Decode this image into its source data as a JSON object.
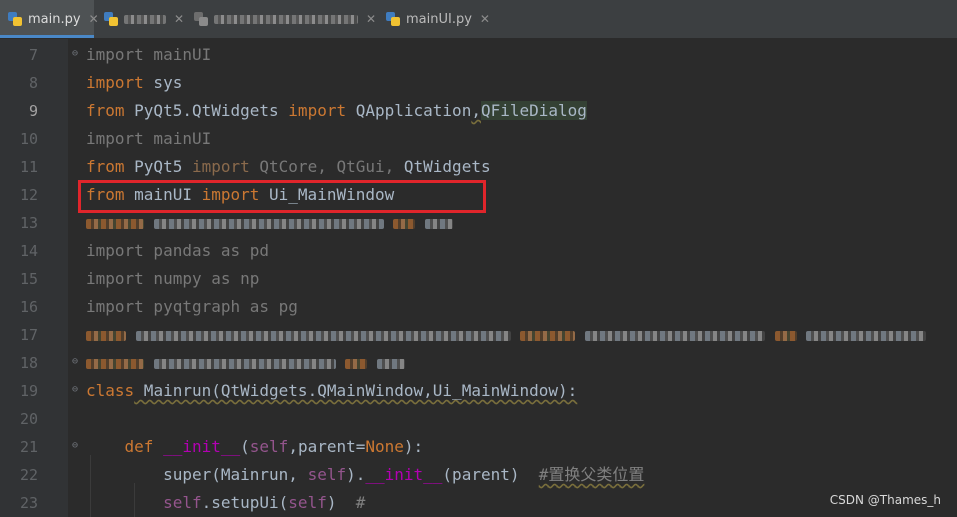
{
  "tabs": [
    {
      "label": "main.py",
      "active": true
    },
    {
      "label": "",
      "active": false
    },
    {
      "label": "",
      "active": false
    },
    {
      "label": "mainUI.py",
      "active": false
    }
  ],
  "line_numbers": [
    "7",
    "8",
    "9",
    "10",
    "11",
    "12",
    "13",
    "14",
    "15",
    "16",
    "17",
    "18",
    "19",
    "20",
    "21",
    "22",
    "23"
  ],
  "current_line": "9",
  "code": {
    "l7": {
      "a": "import mainUI"
    },
    "l8": {
      "kw": "import",
      "rest": " sys"
    },
    "l9": {
      "kw1": "from",
      "mod": " PyQt5.QtWidgets ",
      "kw2": "import",
      "n1": " QApplication",
      "sep": ",",
      "n2": "QFileDialog"
    },
    "l10": {
      "a": "import mainUI"
    },
    "l11": {
      "kw1": "from",
      "mod": " PyQt5 ",
      "kw2": "import",
      "d1": " QtCore, QtGui, ",
      "n": "QtWidgets"
    },
    "l12": {
      "kw1": "from",
      "mod": " mainUI ",
      "kw2": "import",
      "n": " Ui_MainWindow"
    },
    "l14": {
      "a": "import pandas as pd"
    },
    "l15": {
      "a": "import numpy as np"
    },
    "l16": {
      "a": "import pyqtgraph as pg"
    },
    "l19": {
      "kw": "class",
      "sig": " Mainrun(QtWidgets.QMainWindow,Ui_MainWindow):"
    },
    "l21": {
      "kw": "def",
      "fn": " __init__",
      "p1": "(",
      "self": "self",
      "p2": ",parent=",
      "none": "None",
      "p3": "):"
    },
    "l22": {
      "sup": "super",
      "a1": "(Mainrun, ",
      "self": "self",
      "a2": ").",
      "fn": "__init__",
      "a3": "(parent)  ",
      "com": "#置换父类位置"
    },
    "l23": {
      "self": "self",
      "a1": ".setupUi(",
      "self2": "self",
      "a2": ")  ",
      "com": "#"
    }
  },
  "watermark": "CSDN @Thames_h"
}
